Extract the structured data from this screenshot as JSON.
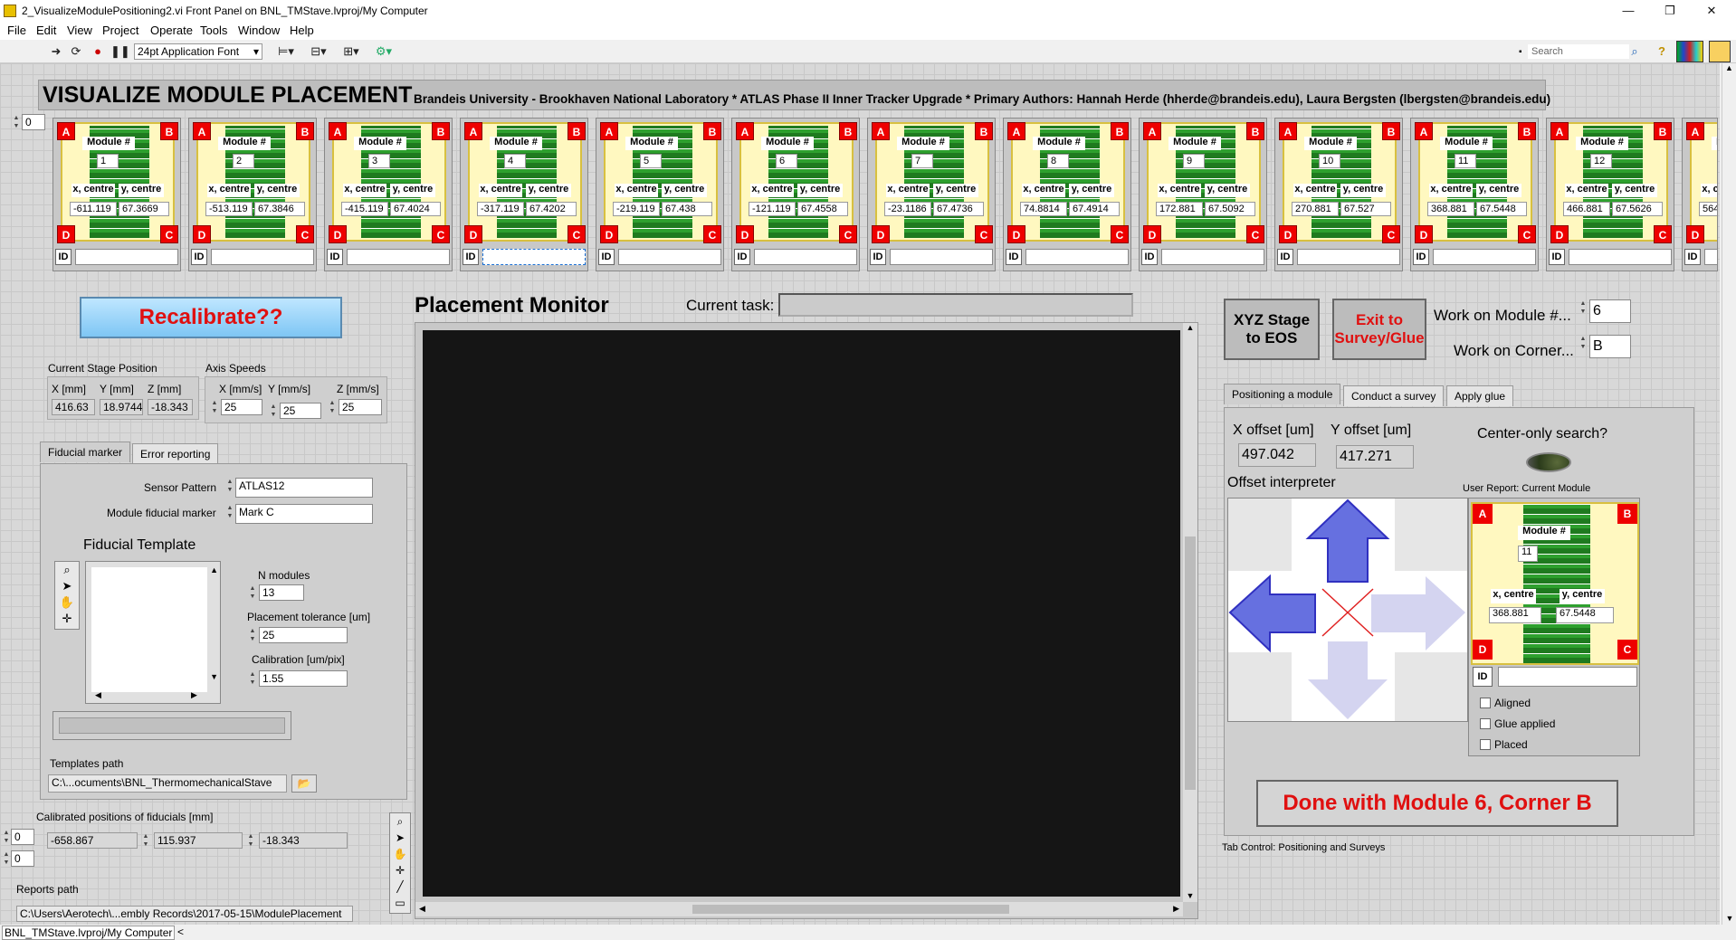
{
  "window": {
    "title": "2_VisualizeModulePositioning2.vi Front Panel on BNL_TMStave.lvproj/My Computer",
    "minimize": "—",
    "restore": "❐",
    "close": "✕"
  },
  "menu": [
    "File",
    "Edit",
    "View",
    "Project",
    "Operate",
    "Tools",
    "Window",
    "Help"
  ],
  "toolbar": {
    "font": "24pt Application Font",
    "search_placeholder": "Search"
  },
  "header": {
    "title": "VISUALIZE MODULE PLACEMENT",
    "subtitle": "Brandeis University - Brookhaven National Laboratory * ATLAS Phase II Inner Tracker Upgrade * Primary Authors: Hannah Herde (hherde@brandeis.edu), Laura Bergsten (lbergsten@brandeis.edu)"
  },
  "array_index": "0",
  "module_labels": {
    "module": "Module #",
    "x": "x, centre",
    "y": "y, centre",
    "id": "ID",
    "a": "A",
    "b": "B",
    "c": "C",
    "d": "D"
  },
  "modules": [
    {
      "num": "1",
      "x": "-611.119",
      "y": "67.3669"
    },
    {
      "num": "2",
      "x": "-513.119",
      "y": "67.3846"
    },
    {
      "num": "3",
      "x": "-415.119",
      "y": "67.4024"
    },
    {
      "num": "4",
      "x": "-317.119",
      "y": "67.4202"
    },
    {
      "num": "5",
      "x": "-219.119",
      "y": "67.438"
    },
    {
      "num": "6",
      "x": "-121.119",
      "y": "67.4558"
    },
    {
      "num": "7",
      "x": "-23.1186",
      "y": "67.4736"
    },
    {
      "num": "8",
      "x": "74.8814",
      "y": "67.4914"
    },
    {
      "num": "9",
      "x": "172.881",
      "y": "67.5092"
    },
    {
      "num": "10",
      "x": "270.881",
      "y": "67.527"
    },
    {
      "num": "11",
      "x": "368.881",
      "y": "67.5448"
    },
    {
      "num": "12",
      "x": "466.881",
      "y": "67.5626"
    },
    {
      "num": "",
      "x": "564",
      "y": ""
    }
  ],
  "recalibrate": "Recalibrate??",
  "stage": {
    "title": "Current Stage Position",
    "labels": [
      "X [mm]",
      "Y [mm]",
      "Z [mm]"
    ],
    "values": [
      "416.63",
      "18.9744",
      "-18.343"
    ]
  },
  "speeds": {
    "title": "Axis Speeds",
    "labels": [
      "X [mm/s]",
      "Y [mm/s]",
      "Z [mm/s]"
    ],
    "values": [
      "25",
      "25",
      "25"
    ]
  },
  "left_tabs": [
    "Fiducial marker",
    "Error reporting"
  ],
  "fiducial": {
    "sensor_label": "Sensor Pattern",
    "sensor_value": "ATLAS12",
    "marker_label": "Module fiducial marker",
    "marker_value": "Mark C",
    "template_title": "Fiducial Template",
    "nmod_label": "N modules",
    "nmod_value": "13",
    "tol_label": "Placement tolerance [um]",
    "tol_value": "25",
    "cal_label": "Calibration [um/pix]",
    "cal_value": "1.55",
    "templates_label": "Templates path",
    "templates_value": "C:\\...ocuments\\BNL_ThermomechanicalStave"
  },
  "calibrated": {
    "label": "Calibrated positions of fiducials [mm]",
    "idx1": "0",
    "idx2": "0",
    "values": [
      "-658.867",
      "115.937",
      "-18.343"
    ]
  },
  "reports": {
    "label": "Reports path",
    "value": "C:\\Users\\Aerotech\\...embly Records\\2017-05-15\\ModulePlacement"
  },
  "monitor": {
    "title": "Placement Monitor",
    "task_label": "Current task:",
    "task_value": ""
  },
  "right": {
    "xyz_button": "XYZ Stage to EOS",
    "exit_button": "Exit to Survey/Glue",
    "work_module_label": "Work on Module #...",
    "work_module_value": "6",
    "work_corner_label": "Work on Corner...",
    "work_corner_value": "B",
    "tabs": [
      "Positioning a module",
      "Conduct a survey",
      "Apply glue"
    ],
    "xoff_label": "X offset [um]",
    "xoff_value": "497.042",
    "yoff_label": "Y offset [um]",
    "yoff_value": "417.271",
    "center_label": "Center-only search?",
    "interp_label": "Offset interpreter",
    "report_label": "User Report: Current Module",
    "report_module": {
      "num": "11",
      "x": "368.881",
      "y": "67.5448"
    },
    "checks": [
      "Aligned",
      "Glue applied",
      "Placed"
    ],
    "done_button": "Done with Module 6,  Corner B",
    "tab_caption": "Tab Control: Positioning and Surveys"
  },
  "status": "BNL_TMStave.lvproj/My Computer"
}
